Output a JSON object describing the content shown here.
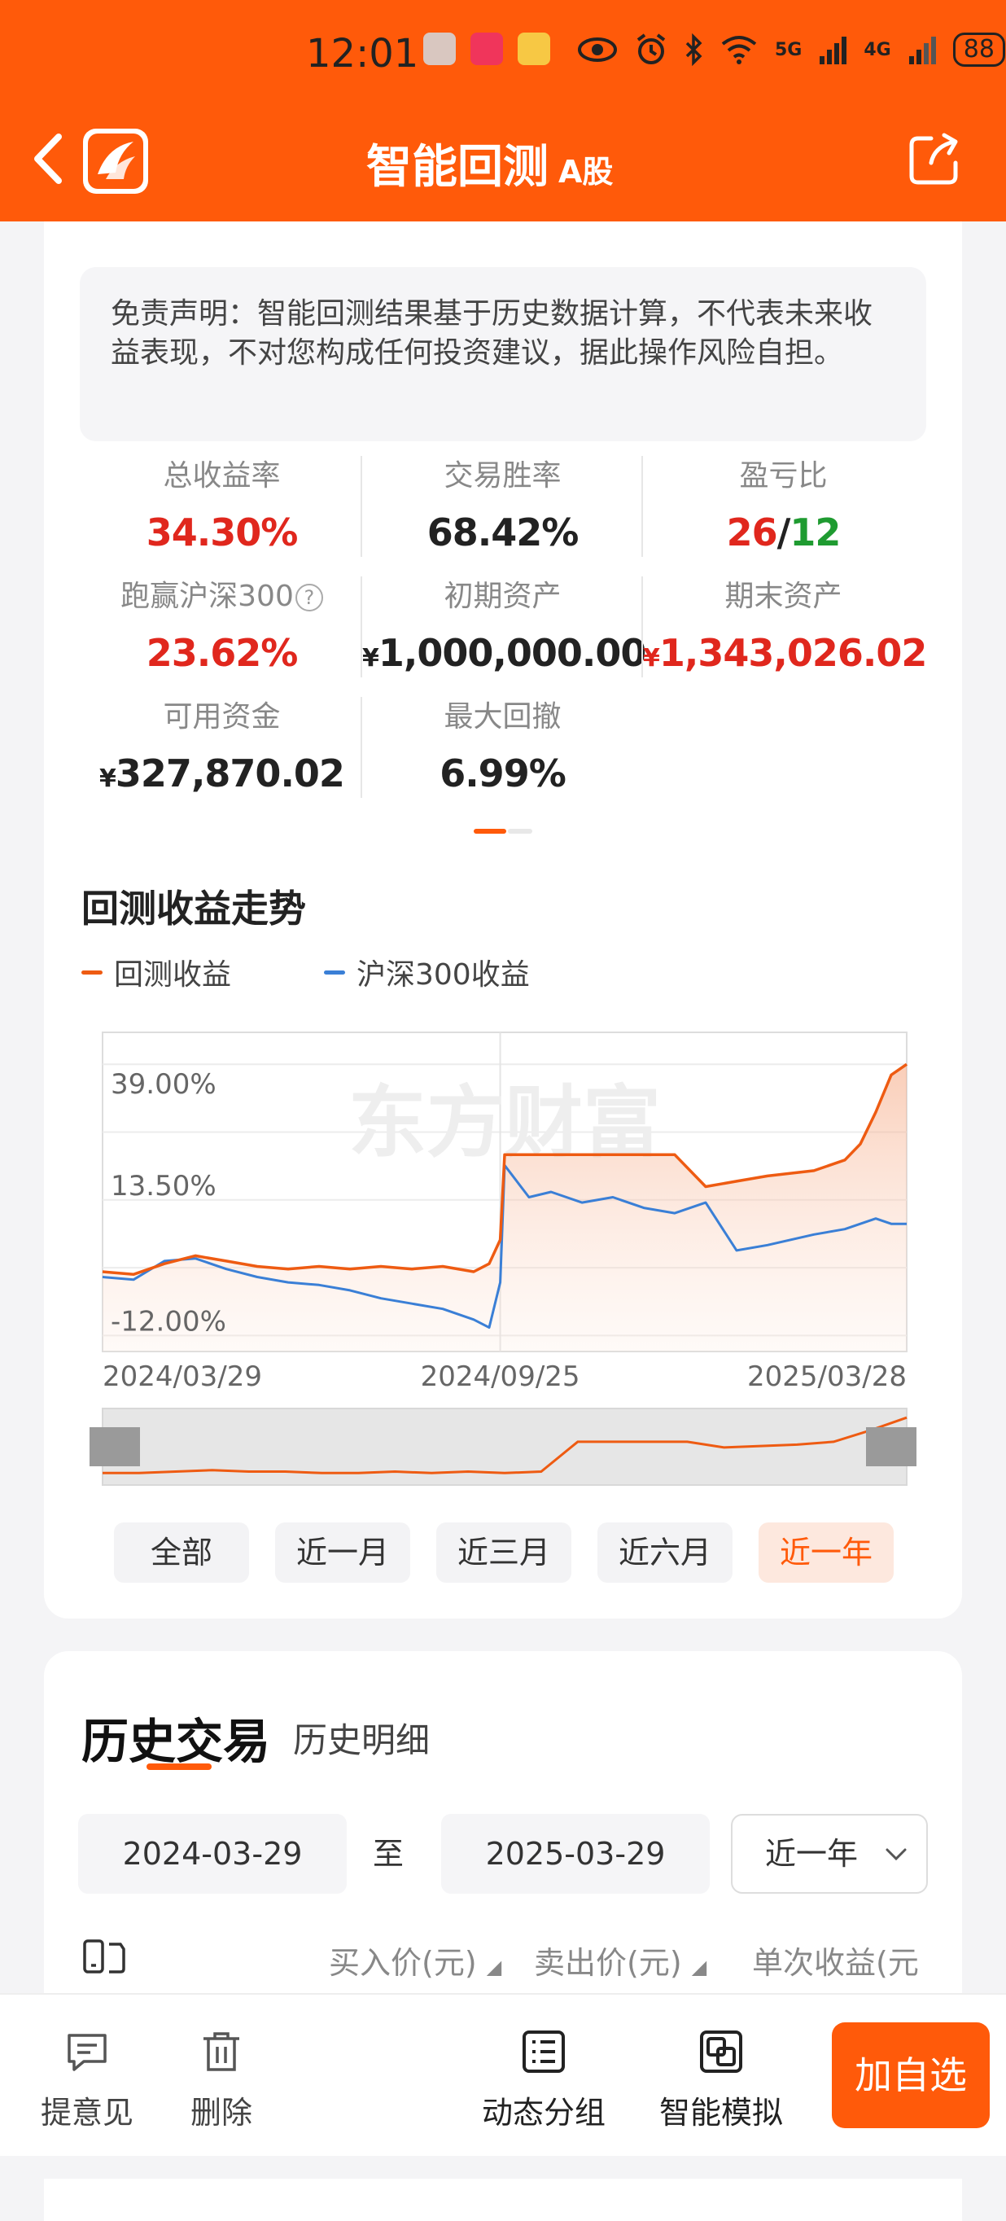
{
  "status_bar": {
    "time": "12:01",
    "battery": "88",
    "net1": "5G",
    "net2": "4G"
  },
  "header": {
    "title": "智能回测",
    "subtitle": "A股"
  },
  "disclaimer": "免责声明：智能回测结果基于历史数据计算，不代表未来收益表现，不对您构成任何投资建议，据此操作风险自担。",
  "metrics": {
    "total_return": {
      "label": "总收益率",
      "value": "34.30%"
    },
    "win_rate": {
      "label": "交易胜率",
      "value": "68.42%"
    },
    "pnl_ratio": {
      "label": "盈亏比",
      "win": "26",
      "sep": "/",
      "loss": "12"
    },
    "beat_index": {
      "label": "跑赢沪深300",
      "value": "23.62%"
    },
    "initial_assets": {
      "label": "初期资产",
      "currency": "¥",
      "value": "1,000,000.00"
    },
    "final_assets": {
      "label": "期末资产",
      "currency": "¥",
      "value": "1,343,026.02"
    },
    "available_cash": {
      "label": "可用资金",
      "currency": "¥",
      "value": "327,870.02"
    },
    "max_drawdown": {
      "label": "最大回撤",
      "value": "6.99%"
    }
  },
  "chart_section": {
    "title": "回测收益走势",
    "legend": [
      "回测收益",
      "沪深300收益"
    ],
    "watermark": "东方财富",
    "range_buttons": [
      "全部",
      "近一月",
      "近三月",
      "近六月",
      "近一年"
    ],
    "active_range": "近一年"
  },
  "colors": {
    "brand": "#ff5a0a",
    "series_backtest": "#ee5b12",
    "series_hs300": "#3a7fd6",
    "positive": "#e0271d",
    "negative": "#1f9b31"
  },
  "chart_data": {
    "type": "line",
    "x_ticks": [
      "2024/03/29",
      "2024/09/25",
      "2025/03/28"
    ],
    "y_ticks": [
      "39.00%",
      "13.50%",
      "-12.00%"
    ],
    "ylim": [
      -15,
      45
    ],
    "series": [
      {
        "name": "回测收益",
        "x": [
          "2024/03/29",
          "2024/04/12",
          "2024/04/26",
          "2024/05/10",
          "2024/05/24",
          "2024/06/07",
          "2024/06/21",
          "2024/07/05",
          "2024/07/19",
          "2024/08/02",
          "2024/08/16",
          "2024/08/30",
          "2024/09/13",
          "2024/09/20",
          "2024/09/25",
          "2024/09/27",
          "2024/10/08",
          "2024/11/01",
          "2024/11/29",
          "2024/12/13",
          "2024/12/27",
          "2025/01/10",
          "2025/01/24",
          "2025/02/14",
          "2025/02/28",
          "2025/03/07",
          "2025/03/14",
          "2025/03/21",
          "2025/03/28"
        ],
        "values": [
          0,
          -0.5,
          1.5,
          3,
          2,
          1,
          0.5,
          1,
          0.5,
          1,
          0.5,
          1,
          0,
          1.5,
          6,
          22,
          22,
          22,
          22,
          22,
          16,
          17,
          18,
          19,
          21,
          24,
          30,
          37,
          39
        ]
      },
      {
        "name": "沪深300收益",
        "x": [
          "2024/03/29",
          "2024/04/12",
          "2024/04/26",
          "2024/05/10",
          "2024/05/24",
          "2024/06/07",
          "2024/06/21",
          "2024/07/05",
          "2024/07/19",
          "2024/08/02",
          "2024/08/16",
          "2024/08/30",
          "2024/09/13",
          "2024/09/20",
          "2024/09/25",
          "2024/09/27",
          "2024/10/08",
          "2024/10/18",
          "2024/11/01",
          "2024/11/15",
          "2024/11/29",
          "2024/12/13",
          "2024/12/27",
          "2025/01/10",
          "2025/01/24",
          "2025/02/14",
          "2025/02/28",
          "2025/03/07",
          "2025/03/14",
          "2025/03/21",
          "2025/03/28"
        ],
        "values": [
          -1,
          -1.5,
          2,
          2.5,
          0.5,
          -1,
          -2,
          -2.5,
          -3.5,
          -5,
          -6,
          -7,
          -9,
          -10.5,
          -2,
          20,
          14,
          15,
          13,
          14,
          12,
          11,
          13,
          4,
          5,
          7,
          8,
          9,
          10,
          9,
          9
        ]
      }
    ],
    "navigator": {
      "values": [
        0,
        0,
        1,
        2,
        1,
        1,
        0,
        0,
        1,
        0,
        1,
        0,
        1,
        22,
        22,
        22,
        22,
        18,
        19,
        20,
        22,
        30,
        39
      ]
    }
  },
  "history": {
    "tab_main": "历史交易",
    "tab_sub": "历史明细",
    "start_date": "2024-03-29",
    "to_label": "至",
    "end_date": "2025-03-29",
    "period_select": "近一年",
    "columns": [
      "买入价(元)",
      "卖出价(元)",
      "单次收益(元"
    ]
  },
  "bottom_bar": {
    "feedback": "提意见",
    "delete": "删除",
    "dynamic_group": "动态分组",
    "smart_sim": "智能模拟",
    "add_watchlist": "加自选"
  }
}
